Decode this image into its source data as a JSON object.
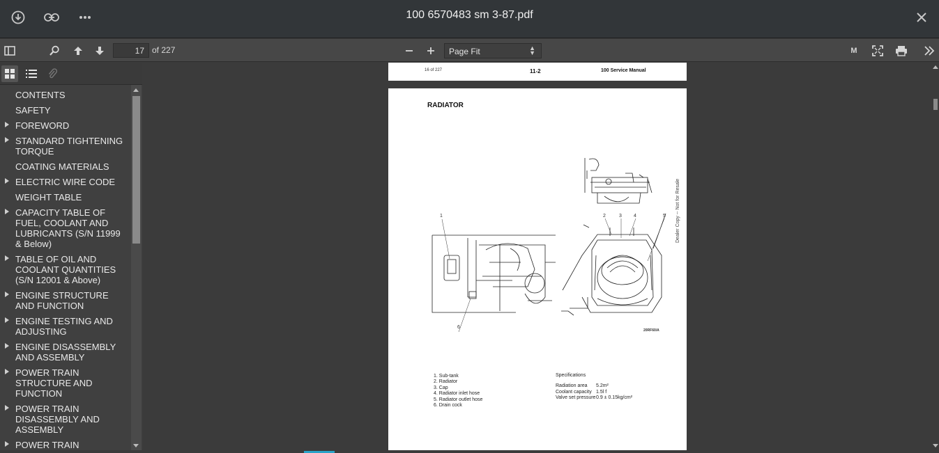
{
  "window": {
    "title": "100 6570483 sm 3-87.pdf"
  },
  "icons": {
    "download": "download-icon",
    "link": "link-icon",
    "more": "more-icon",
    "close": "close-icon",
    "sidebar_toggle": "sidebar-toggle-icon",
    "search": "search-icon",
    "prev_page": "arrow-up-icon",
    "next_page": "arrow-down-icon",
    "zoom_out": "minus-icon",
    "zoom_in": "plus-icon",
    "presentation": "presentation-icon",
    "fullscreen": "fullscreen-icon",
    "print": "print-icon",
    "tools": "double-chevron-right-icon"
  },
  "toolbar": {
    "page_number": "17",
    "page_total_label": "of 227",
    "zoom_value": "Page Fit",
    "mode_label": "M"
  },
  "outline": {
    "items": [
      {
        "label": "CONTENTS",
        "expandable": false
      },
      {
        "label": "SAFETY",
        "expandable": false
      },
      {
        "label": "FOREWORD",
        "expandable": true
      },
      {
        "label": "STANDARD TIGHTENING TORQUE",
        "expandable": true
      },
      {
        "label": "COATING MATERIALS",
        "expandable": false
      },
      {
        "label": "ELECTRIC WIRE CODE",
        "expandable": true
      },
      {
        "label": "WEIGHT TABLE",
        "expandable": false
      },
      {
        "label": "CAPACITY TABLE OF FUEL, COOLANT AND LUBRICANTS (S/N 11999 & Below)",
        "expandable": true
      },
      {
        "label": "TABLE OF OIL AND COOLANT QUANTITIES (S/N 12001 & Above)",
        "expandable": true
      },
      {
        "label": "ENGINE STRUCTURE AND FUNCTION",
        "expandable": true
      },
      {
        "label": "ENGINE TESTING AND ADJUSTING",
        "expandable": true
      },
      {
        "label": "ENGINE DISASSEMBLY AND ASSEMBLY",
        "expandable": true
      },
      {
        "label": "POWER TRAIN STRUCTURE AND FUNCTION",
        "expandable": true
      },
      {
        "label": "POWER TRAIN DISASSEMBLY AND ASSEMBLY",
        "expandable": true
      },
      {
        "label": "POWER TRAIN",
        "expandable": true
      }
    ]
  },
  "document": {
    "prev_page_header": {
      "page_of": "16 of 227",
      "page_code": "11-2",
      "manual": "100 Service Manual"
    },
    "heading": "RADIATOR",
    "callouts": [
      "1",
      "2",
      "3",
      "4",
      "5",
      "6"
    ],
    "figure_code": "20RF60/A",
    "side_note": "Dealer Copy -- Not for Resale",
    "legend": [
      "1. Sub-tank",
      "2. Radiator",
      "3. Cap",
      "4. Radiator inlet hose",
      "5. Radiator outlet hose",
      "6. Drain cock"
    ],
    "specs_title": "Specifications",
    "specs": [
      {
        "name": "Radiation area",
        "value": "5.2m²"
      },
      {
        "name": "Coolant capacity",
        "value": "1.5l f"
      },
      {
        "name": "Valve set pressure",
        "value": "0.9 ± 0.15kg/cm²"
      }
    ]
  }
}
